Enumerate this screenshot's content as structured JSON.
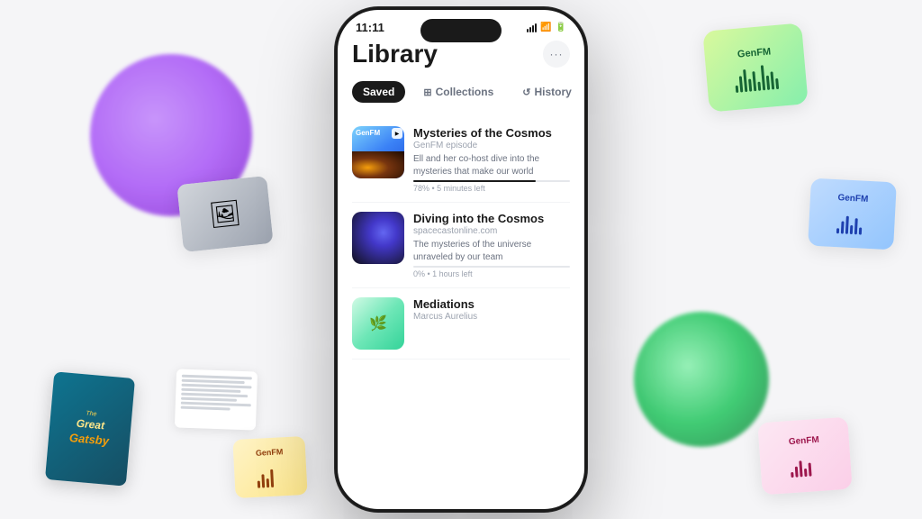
{
  "background": {
    "color": "#f5f5f7"
  },
  "phone": {
    "status_bar": {
      "time": "11:11",
      "signal": "signal",
      "wifi": "wifi",
      "battery": "battery"
    },
    "screen": {
      "title": "Library",
      "more_button": "···",
      "tabs": [
        {
          "label": "Saved",
          "active": true,
          "icon": ""
        },
        {
          "label": "Collections",
          "active": false,
          "icon": "⊞"
        },
        {
          "label": "History",
          "active": false,
          "icon": "↺"
        }
      ],
      "podcast_items": [
        {
          "title": "Mysteries of the Cosmos",
          "source": "GenFM episode",
          "description": "Ell and her co-host dive into the mysteries that make our world",
          "meta": "78% • 5 minutes left",
          "progress": 78,
          "thumb_type": "genfm"
        },
        {
          "title": "Diving into the Cosmos",
          "source": "spacecastonline.com",
          "description": "The mysteries of the universe unraveled by our team",
          "meta": "0% • 1 hours left",
          "progress": 0,
          "thumb_type": "galaxy2"
        },
        {
          "title": "Mediations",
          "source": "Marcus Aurelius",
          "description": "",
          "meta": "",
          "progress": 0,
          "thumb_type": "meditation"
        }
      ]
    }
  },
  "floating_cards": {
    "genfm_top_label": "GenFM",
    "genfm_right_label": "GenFM",
    "genfm_bottom_right_label": "GenFM",
    "genfm_bottom_left_label": "GenFM",
    "gatsby_the": "The",
    "gatsby_great": "Great",
    "gatsby_gatsby": "Gatsby"
  }
}
